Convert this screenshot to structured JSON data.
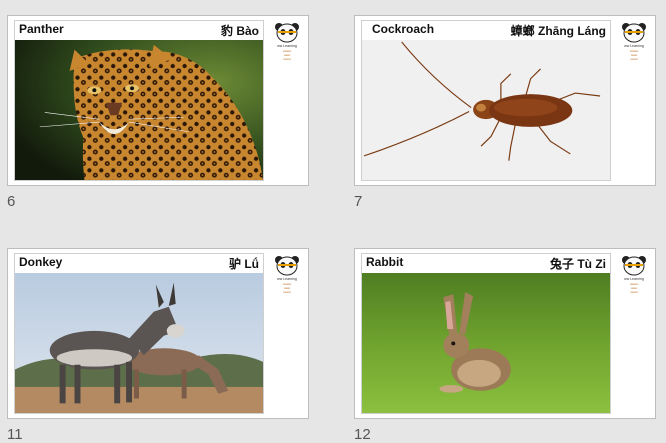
{
  "slides": [
    {
      "number": "6",
      "title_en": "Panther",
      "title_cn": "豹 Bào",
      "image": "leopard-photo"
    },
    {
      "number": "7",
      "title_en": "Cockroach",
      "title_cn": "蟑螂 Zhāng Láng",
      "image": "cockroach-photo"
    },
    {
      "number": "11",
      "title_en": "Donkey",
      "title_cn": "驴 Lǘ",
      "image": "donkey-photo"
    },
    {
      "number": "12",
      "title_en": "Rabbit",
      "title_cn": "兔子 Tù Zi",
      "image": "rabbit-photo"
    }
  ],
  "brand": {
    "name": "ww Learning"
  },
  "colors": {
    "background": "#e6e6e6",
    "border": "#bdbdbd",
    "brand_accent": "#e8a000"
  }
}
